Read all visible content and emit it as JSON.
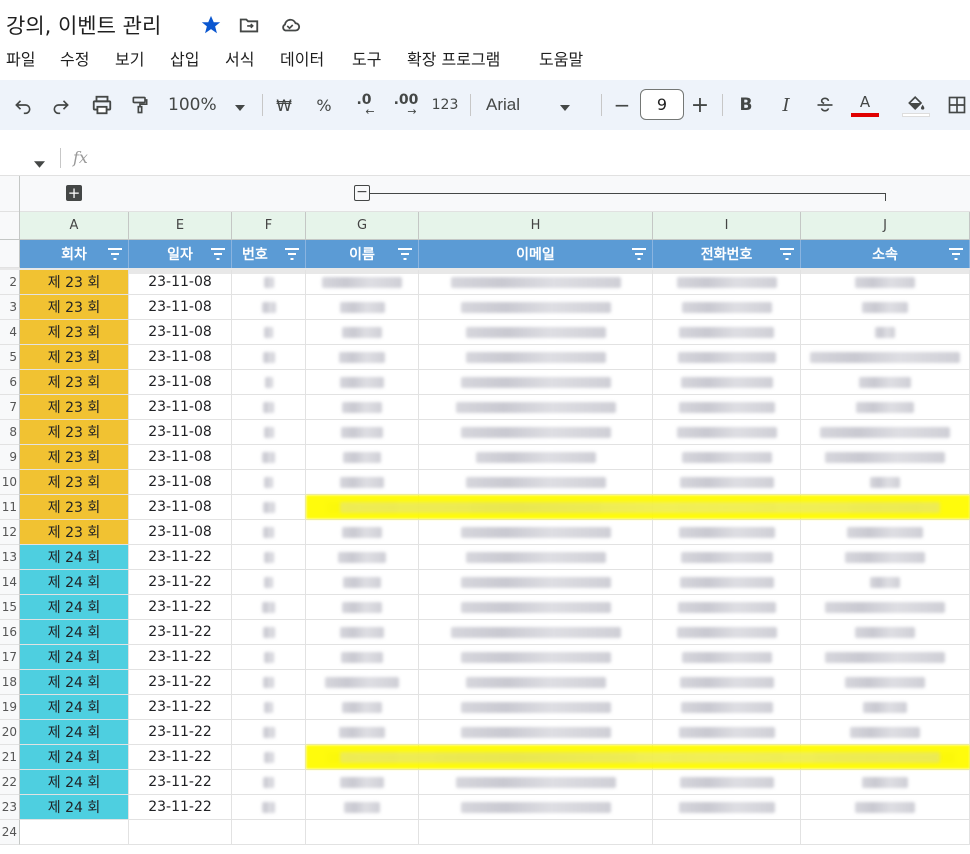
{
  "doc": {
    "title": "강의, 이벤트 관리"
  },
  "menu": [
    "파일",
    "수정",
    "보기",
    "삽입",
    "서식",
    "데이터",
    "도구",
    "확장 프로그램",
    "도움말"
  ],
  "toolbar": {
    "zoom": "100%",
    "currency": "₩",
    "percent": "%",
    "decimal_decrease": ".0",
    "decimal_increase": ".00",
    "number_format": "123",
    "font": "Arial",
    "font_size": "9",
    "minus": "−",
    "plus": "+",
    "bold": "B",
    "italic": "I",
    "text_color_label": "A",
    "text_color": "#ff0000"
  },
  "formula": {
    "fx": "fx"
  },
  "columns": [
    "A",
    "E",
    "F",
    "G",
    "H",
    "I",
    "J"
  ],
  "header": [
    "회차",
    "일자",
    "번호",
    "이름",
    "이메일",
    "전화번호",
    "소속"
  ],
  "rows": [
    {
      "num": "2",
      "round": "제 23 회",
      "date": "23-11-08",
      "group": "a"
    },
    {
      "num": "3",
      "round": "제 23 회",
      "date": "23-11-08",
      "group": "a"
    },
    {
      "num": "4",
      "round": "제 23 회",
      "date": "23-11-08",
      "group": "a"
    },
    {
      "num": "5",
      "round": "제 23 회",
      "date": "23-11-08",
      "group": "a"
    },
    {
      "num": "6",
      "round": "제 23 회",
      "date": "23-11-08",
      "group": "a"
    },
    {
      "num": "7",
      "round": "제 23 회",
      "date": "23-11-08",
      "group": "a"
    },
    {
      "num": "8",
      "round": "제 23 회",
      "date": "23-11-08",
      "group": "a"
    },
    {
      "num": "9",
      "round": "제 23 회",
      "date": "23-11-08",
      "group": "a"
    },
    {
      "num": "10",
      "round": "제 23 회",
      "date": "23-11-08",
      "group": "a"
    },
    {
      "num": "11",
      "round": "제 23 회",
      "date": "23-11-08",
      "group": "a",
      "highlight": true
    },
    {
      "num": "12",
      "round": "제 23 회",
      "date": "23-11-08",
      "group": "a"
    },
    {
      "num": "13",
      "round": "제 24 회",
      "date": "23-11-22",
      "group": "b"
    },
    {
      "num": "14",
      "round": "제 24 회",
      "date": "23-11-22",
      "group": "b"
    },
    {
      "num": "15",
      "round": "제 24 회",
      "date": "23-11-22",
      "group": "b"
    },
    {
      "num": "16",
      "round": "제 24 회",
      "date": "23-11-22",
      "group": "b"
    },
    {
      "num": "17",
      "round": "제 24 회",
      "date": "23-11-22",
      "group": "b"
    },
    {
      "num": "18",
      "round": "제 24 회",
      "date": "23-11-22",
      "group": "b"
    },
    {
      "num": "19",
      "round": "제 24 회",
      "date": "23-11-22",
      "group": "b"
    },
    {
      "num": "20",
      "round": "제 24 회",
      "date": "23-11-22",
      "group": "b"
    },
    {
      "num": "21",
      "round": "제 24 회",
      "date": "23-11-22",
      "group": "b",
      "highlight": true
    },
    {
      "num": "22",
      "round": "제 24 회",
      "date": "23-11-22",
      "group": "b"
    },
    {
      "num": "23",
      "round": "제 24 회",
      "date": "23-11-22",
      "group": "b"
    },
    {
      "num": "24",
      "round": "",
      "date": "",
      "group": "empty"
    }
  ],
  "colors": {
    "round_23": "#f1c232",
    "round_24": "#4ecfe0",
    "header_bg": "#5b9bd5",
    "highlight": "#fffb00"
  }
}
